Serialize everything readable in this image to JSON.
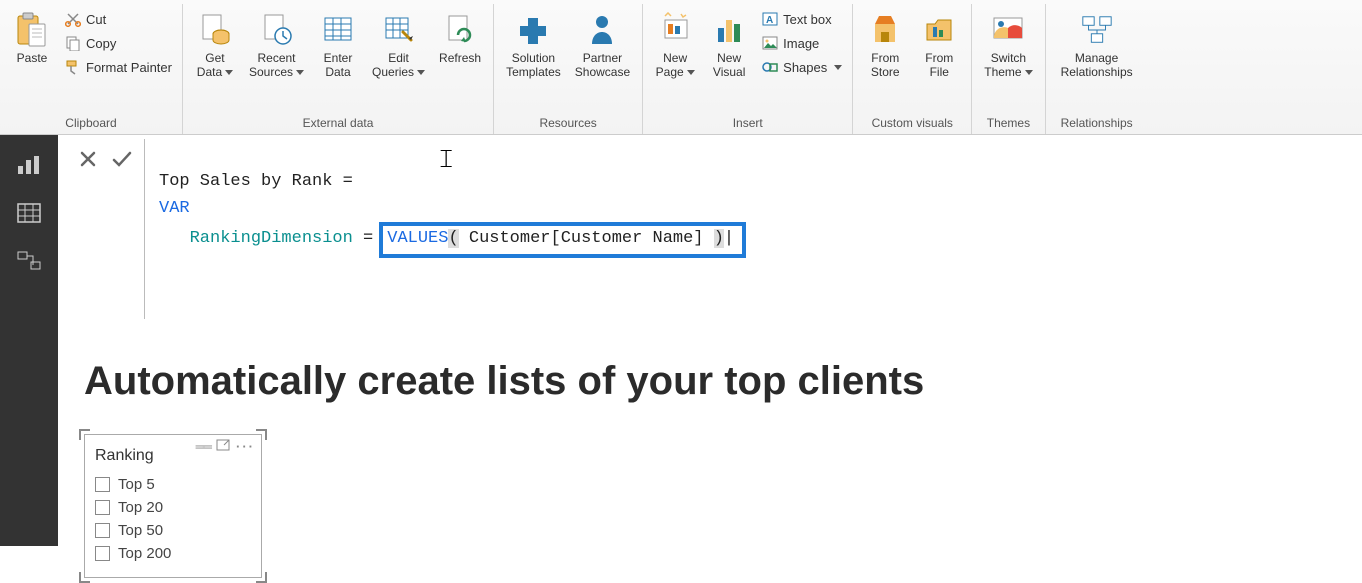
{
  "ribbon": {
    "clipboard": {
      "paste": "Paste",
      "cut": "Cut",
      "copy": "Copy",
      "format_painter": "Format Painter",
      "label": "Clipboard"
    },
    "external_data": {
      "get_data": "Get\nData",
      "recent_sources": "Recent\nSources",
      "enter_data": "Enter\nData",
      "edit_queries": "Edit\nQueries",
      "refresh": "Refresh",
      "label": "External data"
    },
    "resources": {
      "solution_templates": "Solution\nTemplates",
      "partner_showcase": "Partner\nShowcase",
      "label": "Resources"
    },
    "insert": {
      "new_page": "New\nPage",
      "new_visual": "New\nVisual",
      "text_box": "Text box",
      "image": "Image",
      "shapes": "Shapes",
      "label": "Insert"
    },
    "custom_visuals": {
      "from_store": "From\nStore",
      "from_file": "From\nFile",
      "label": "Custom visuals"
    },
    "themes": {
      "switch_theme": "Switch\nTheme",
      "label": "Themes"
    },
    "relationships": {
      "manage": "Manage\nRelationships",
      "label": "Relationships"
    }
  },
  "formula": {
    "line1_a": "Top Sales by Rank ",
    "line1_b": "=",
    "line2": "VAR",
    "line3_a": "RankingDimension ",
    "line3_eq": "=",
    "hl_fn": "VALUES",
    "hl_open": "(",
    "hl_arg": " Customer[Customer Name] ",
    "hl_close": ")",
    "caret": "|"
  },
  "report": {
    "title": "Automatically create lists of your top clients",
    "slicer": {
      "title": "Ranking",
      "items": [
        "Top 5",
        "Top 20",
        "Top 50",
        "Top 200"
      ]
    }
  }
}
